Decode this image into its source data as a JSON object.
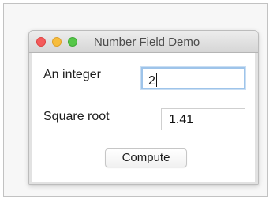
{
  "window": {
    "title": "Number Field Demo",
    "traffic_lights": {
      "close_color": "#f45b5c",
      "minimize_color": "#f7bd3d",
      "maximize_color": "#56c749"
    }
  },
  "form": {
    "integer_label": "An integer",
    "integer_value": "2",
    "sqrt_label": "Square root",
    "sqrt_value": "1.41",
    "compute_label": "Compute"
  }
}
